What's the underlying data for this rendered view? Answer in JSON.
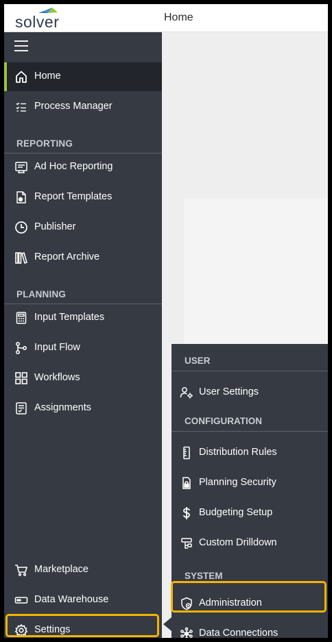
{
  "brand": {
    "logo_text": "solver",
    "logo_colors": [
      "#3d8fd6",
      "#9ac53c",
      "#2f3a4f"
    ]
  },
  "header": {
    "title": "Home"
  },
  "sidebar": {
    "menu_icon": "hamburger-icon",
    "items": [
      {
        "label": "Home",
        "icon": "home-icon",
        "active": true
      },
      {
        "label": "Process Manager",
        "icon": "checklist-icon"
      }
    ],
    "sections": [
      {
        "title": "REPORTING",
        "items": [
          {
            "label": "Ad Hoc Reporting",
            "icon": "report-icon"
          },
          {
            "label": "Report Templates",
            "icon": "document-settings-icon"
          },
          {
            "label": "Publisher",
            "icon": "clock-icon"
          },
          {
            "label": "Report Archive",
            "icon": "books-icon"
          }
        ]
      },
      {
        "title": "PLANNING",
        "items": [
          {
            "label": "Input Templates",
            "icon": "calculator-icon"
          },
          {
            "label": "Input Flow",
            "icon": "flow-icon"
          },
          {
            "label": "Workflows",
            "icon": "grid-icon"
          },
          {
            "label": "Assignments",
            "icon": "list-icon"
          }
        ]
      }
    ],
    "bottom_items": [
      {
        "label": "Marketplace",
        "icon": "cart-icon"
      },
      {
        "label": "Data Warehouse",
        "icon": "drive-icon"
      },
      {
        "label": "Settings",
        "icon": "gear-icon",
        "highlighted": true
      }
    ]
  },
  "flyout": {
    "sections": [
      {
        "title": "USER",
        "items": [
          {
            "label": "User Settings",
            "icon": "user-settings-icon"
          }
        ]
      },
      {
        "title": "CONFIGURATION",
        "items": [
          {
            "label": "Distribution Rules",
            "icon": "ruler-icon"
          },
          {
            "label": "Planning Security",
            "icon": "document-lock-icon"
          },
          {
            "label": "Budgeting Setup",
            "icon": "dollar-icon"
          },
          {
            "label": "Custom Drilldown",
            "icon": "drilldown-icon"
          }
        ]
      },
      {
        "title": "SYSTEM",
        "items": [
          {
            "label": "Administration",
            "icon": "shield-icon",
            "highlighted": true
          },
          {
            "label": "Data Connections",
            "icon": "network-icon"
          }
        ]
      }
    ]
  },
  "colors": {
    "sidebar_bg": "#353a43",
    "active_bg": "#22262c",
    "active_accent": "#9ac53c",
    "highlight": "#f5b400"
  }
}
